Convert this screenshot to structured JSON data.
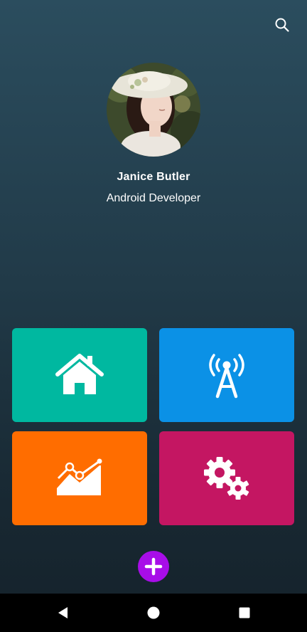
{
  "profile": {
    "name": "Janice Butler",
    "role": "Android Developer"
  },
  "header": {
    "search_icon": "search-icon"
  },
  "tiles": [
    {
      "icon": "home-icon",
      "color": "#00b8a0"
    },
    {
      "icon": "radio-tower-icon",
      "color": "#0b91e6"
    },
    {
      "icon": "line-chart-icon",
      "color": "#ff6d00"
    },
    {
      "icon": "gears-icon",
      "color": "#c41662"
    }
  ],
  "fab": {
    "icon": "plus-icon",
    "color": "#a80de8"
  },
  "navbar": {
    "back_icon": "back-triangle-icon",
    "home_icon": "home-circle-icon",
    "recents_icon": "recents-square-icon"
  }
}
